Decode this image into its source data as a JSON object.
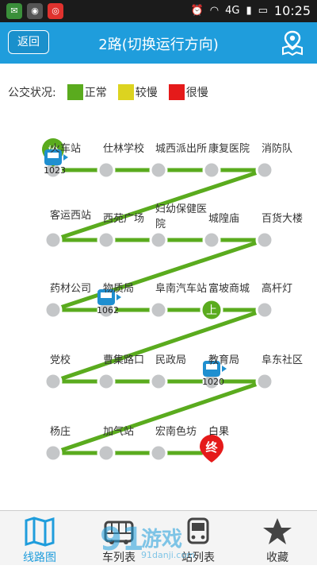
{
  "statusbar": {
    "time": "10:25",
    "network": "4G"
  },
  "header": {
    "back_label": "返回",
    "title": "2路(切换运行方向)"
  },
  "legend": {
    "label": "公交状况:",
    "items": [
      {
        "label": "正常",
        "color": "#5aab1e"
      },
      {
        "label": "较慢",
        "color": "#dcd320"
      },
      {
        "label": "很慢",
        "color": "#e51a1a"
      }
    ]
  },
  "route": {
    "line_color": "#5aab1e",
    "stops": [
      {
        "name": "火车站"
      },
      {
        "name": "仕林学校"
      },
      {
        "name": "城西派出所"
      },
      {
        "name": "康复医院"
      },
      {
        "name": "消防队"
      },
      {
        "name": "客运西站"
      },
      {
        "name": "西苑广场"
      },
      {
        "name": "妇幼保健医院"
      },
      {
        "name": "城隍庙"
      },
      {
        "name": "百货大楼"
      },
      {
        "name": "药材公司"
      },
      {
        "name": "物质局"
      },
      {
        "name": "阜南汽车站"
      },
      {
        "name": "富坡商城"
      },
      {
        "name": "高杆灯"
      },
      {
        "name": "党校"
      },
      {
        "name": "曹集路口"
      },
      {
        "name": "民政局"
      },
      {
        "name": "教育局"
      },
      {
        "name": "阜东社区"
      },
      {
        "name": "杨庄"
      },
      {
        "name": "加气站"
      },
      {
        "name": "宏南色坊"
      },
      {
        "name": "白果"
      }
    ],
    "buses": [
      {
        "id": "1023"
      },
      {
        "id": "1062"
      },
      {
        "id": "1020"
      }
    ],
    "start_marker": "始",
    "board_marker": "上",
    "end_marker": "终"
  },
  "tabs": [
    {
      "label": "线路图",
      "icon": "map-book-icon",
      "active": true
    },
    {
      "label": "车列表",
      "icon": "bus-icon",
      "active": false
    },
    {
      "label": "站列表",
      "icon": "station-bus-icon",
      "active": false
    },
    {
      "label": "收藏",
      "icon": "star-icon",
      "active": false
    }
  ],
  "watermark": {
    "text": "游戏",
    "sub": "91danji.com"
  }
}
